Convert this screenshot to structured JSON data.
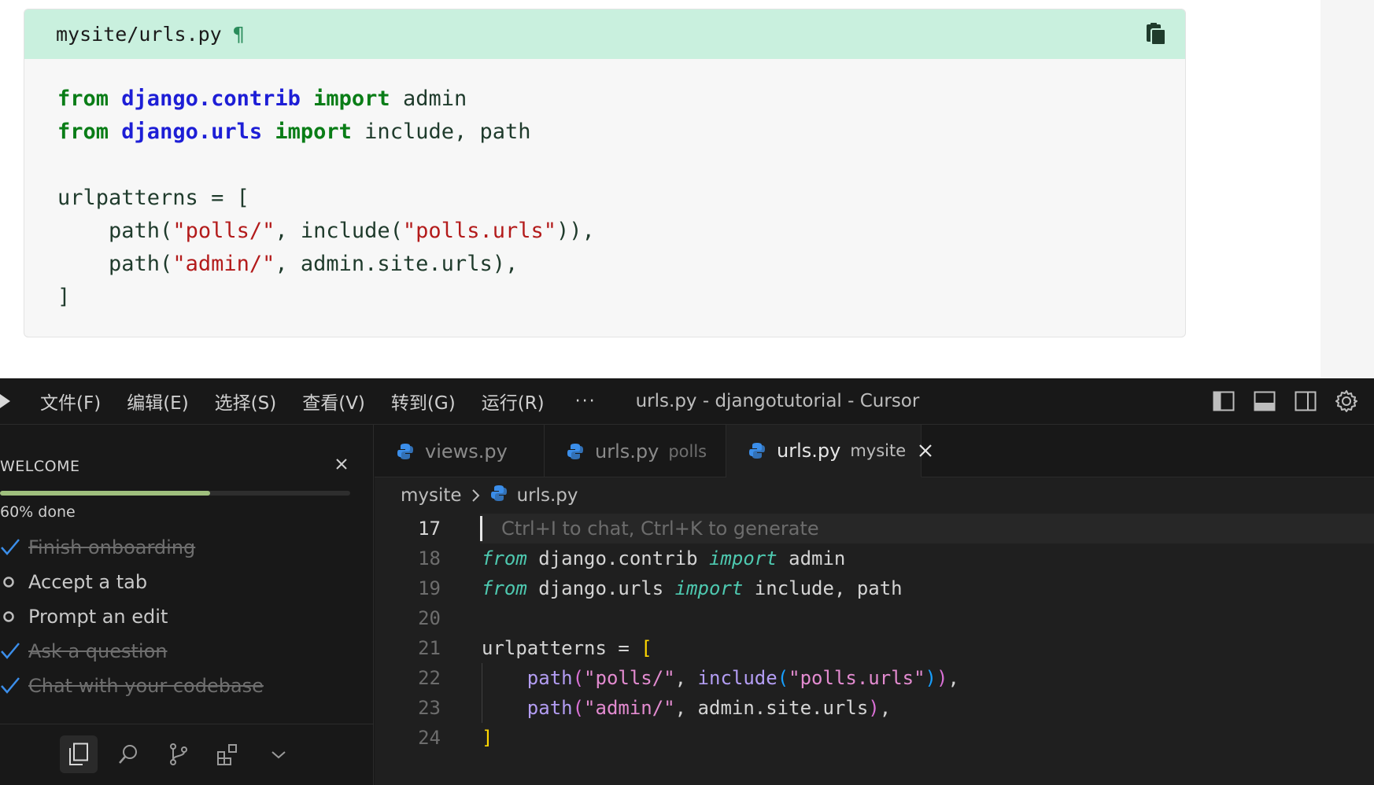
{
  "doc": {
    "filename": "mysite/urls.py",
    "pilcrow": "¶",
    "code_lines": [
      [
        {
          "t": "from",
          "c": "k-green"
        },
        {
          "t": " ",
          "c": "k-plain"
        },
        {
          "t": "django.contrib",
          "c": "k-blue"
        },
        {
          "t": " ",
          "c": "k-plain"
        },
        {
          "t": "import",
          "c": "k-green"
        },
        {
          "t": " admin",
          "c": "k-plain"
        }
      ],
      [
        {
          "t": "from",
          "c": "k-green"
        },
        {
          "t": " ",
          "c": "k-plain"
        },
        {
          "t": "django.urls",
          "c": "k-blue"
        },
        {
          "t": " ",
          "c": "k-plain"
        },
        {
          "t": "import",
          "c": "k-green"
        },
        {
          "t": " include, path",
          "c": "k-plain"
        }
      ],
      [],
      [
        {
          "t": "urlpatterns = [",
          "c": "k-plain"
        }
      ],
      [
        {
          "t": "    path(",
          "c": "k-plain"
        },
        {
          "t": "\"polls/\"",
          "c": "k-str"
        },
        {
          "t": ", include(",
          "c": "k-plain"
        },
        {
          "t": "\"polls.urls\"",
          "c": "k-str"
        },
        {
          "t": ")),",
          "c": "k-plain"
        }
      ],
      [
        {
          "t": "    path(",
          "c": "k-plain"
        },
        {
          "t": "\"admin/\"",
          "c": "k-str"
        },
        {
          "t": ", admin.site.urls),",
          "c": "k-plain"
        }
      ],
      [
        {
          "t": "]",
          "c": "k-plain"
        }
      ]
    ]
  },
  "titlebar": {
    "menu": [
      "文件(F)",
      "编辑(E)",
      "选择(S)",
      "查看(V)",
      "转到(G)",
      "运行(R)"
    ],
    "more": "···",
    "title": "urls.py - djangotutorial - Cursor"
  },
  "welcome": {
    "title": "WELCOME",
    "progress": 0.6,
    "progress_text": "60% done",
    "items": [
      {
        "label": "Finish onboarding",
        "done": true
      },
      {
        "label": "Accept a tab",
        "done": false
      },
      {
        "label": "Prompt an edit",
        "done": false
      },
      {
        "label": "Ask a question",
        "done": true
      },
      {
        "label": "Chat with your codebase",
        "done": true
      }
    ]
  },
  "tabs": [
    {
      "label": "views.py",
      "desc": "",
      "active": false
    },
    {
      "label": "urls.py",
      "desc": "polls",
      "active": false
    },
    {
      "label": "urls.py",
      "desc": "mysite",
      "active": true
    }
  ],
  "breadcrumb": {
    "folder": "mysite",
    "file": "urls.py"
  },
  "editor": {
    "hint": "Ctrl+I to chat, Ctrl+K to generate",
    "line_numbers": [
      "17",
      "18",
      "19",
      "20",
      "21",
      "22",
      "23",
      "24"
    ],
    "current_line": "17",
    "code_lines": [
      [],
      [
        {
          "t": "from",
          "c": "c-kw"
        },
        {
          "t": " django.contrib ",
          "c": "c-plain"
        },
        {
          "t": "import",
          "c": "c-kw"
        },
        {
          "t": " admin",
          "c": "c-plain"
        }
      ],
      [
        {
          "t": "from",
          "c": "c-kw"
        },
        {
          "t": " django.urls ",
          "c": "c-plain"
        },
        {
          "t": "import",
          "c": "c-kw"
        },
        {
          "t": " include, path",
          "c": "c-plain"
        }
      ],
      [],
      [
        {
          "t": "urlpatterns = ",
          "c": "c-plain"
        },
        {
          "t": "[",
          "c": "c-br1"
        }
      ],
      [
        {
          "t": "    ",
          "c": "c-plain"
        },
        {
          "t": "path",
          "c": "c-fn2"
        },
        {
          "t": "(",
          "c": "c-br2"
        },
        {
          "t": "\"polls/\"",
          "c": "c-str"
        },
        {
          "t": ", ",
          "c": "c-plain"
        },
        {
          "t": "include",
          "c": "c-fn2"
        },
        {
          "t": "(",
          "c": "c-br3"
        },
        {
          "t": "\"polls.urls\"",
          "c": "c-str"
        },
        {
          "t": ")",
          "c": "c-br3"
        },
        {
          "t": ")",
          "c": "c-br2"
        },
        {
          "t": ",",
          "c": "c-plain"
        }
      ],
      [
        {
          "t": "    ",
          "c": "c-plain"
        },
        {
          "t": "path",
          "c": "c-fn2"
        },
        {
          "t": "(",
          "c": "c-br2"
        },
        {
          "t": "\"admin/\"",
          "c": "c-str"
        },
        {
          "t": ", admin.site.urls",
          "c": "c-plain"
        },
        {
          "t": ")",
          "c": "c-br2"
        },
        {
          "t": ",",
          "c": "c-plain"
        }
      ],
      [
        {
          "t": "]",
          "c": "c-br1"
        }
      ]
    ]
  },
  "colors": {
    "header_bg": "#c9f0de",
    "editor_bg": "#1f1f1f",
    "progress": "#9fbf7d",
    "check": "#3b8eea"
  }
}
